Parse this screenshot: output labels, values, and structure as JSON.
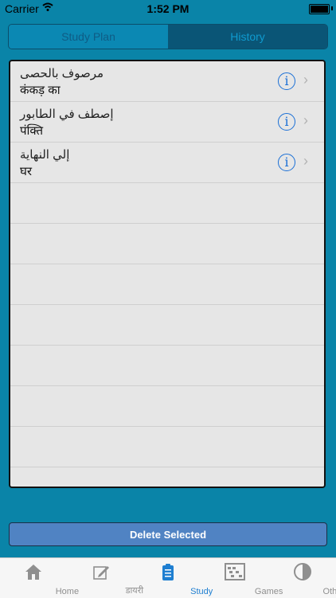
{
  "status": {
    "carrier": "Carrier",
    "time": "1:52 PM"
  },
  "segmented": {
    "study_plan": "Study Plan",
    "history": "History",
    "selected": "History"
  },
  "rows": [
    {
      "line1": "مرصوف بالحصى",
      "line2": "कंकड़ का"
    },
    {
      "line1": "إصطف في الطابور",
      "line2": "पंक्ति"
    },
    {
      "line1": "إلي النهاية",
      "line2": "घर"
    }
  ],
  "actions": {
    "delete_selected": "Delete Selected"
  },
  "tabs": [
    {
      "label": "Home",
      "icon": "home-icon"
    },
    {
      "label": "डायरी",
      "icon": "pencil-edit-icon"
    },
    {
      "label": "Study",
      "icon": "clipboard-icon",
      "active": true
    },
    {
      "label": "Games",
      "icon": "abacus-icon"
    },
    {
      "label": "Others",
      "icon": "contrast-icon"
    }
  ]
}
